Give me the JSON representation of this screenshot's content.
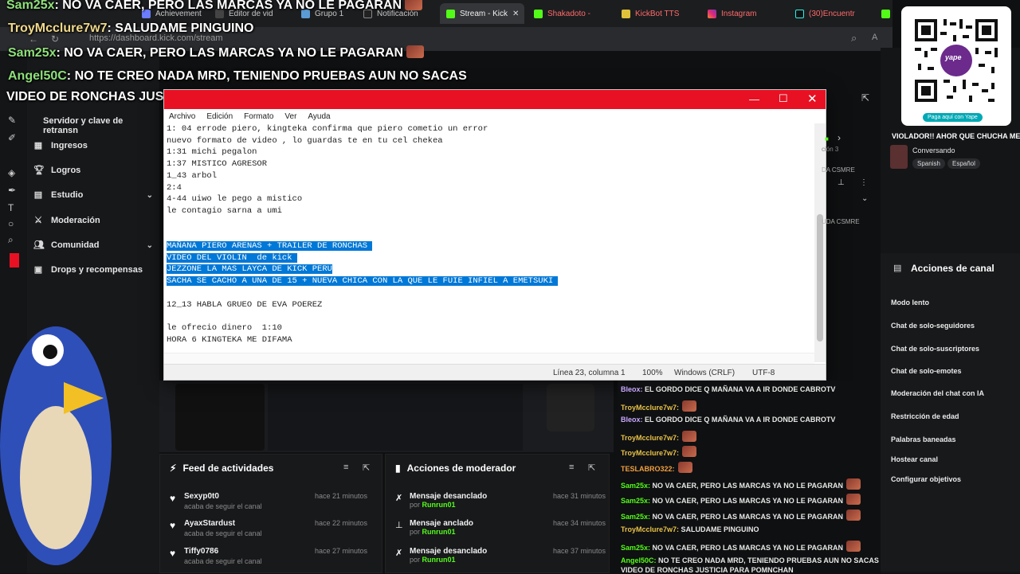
{
  "overlay_chat": [
    {
      "user": "Sam25x",
      "msg": ": NO VA CAER, PERO LAS MARCAS YA NO LE PAGARAN"
    },
    {
      "user": "TroyMcclure7w7",
      "msg": ": SALUDAME PINGUINO"
    },
    {
      "user": "Sam25x",
      "msg": ": NO VA CAER, PERO LAS MARCAS YA NO LE PAGARAN"
    },
    {
      "user": "Angel50C",
      "msg": ": NO TE CREO NADA MRD, TENIENDO PRUEBAS AUN NO SACAS"
    },
    {
      "user": "",
      "msg": "VIDEO DE RONCHAS JUSTICIA PARA POMNCHAN"
    }
  ],
  "browser": {
    "tabs": [
      "Achievement",
      "Editor de vid",
      "Grupo 1",
      "Notificación",
      "Stream - Kick",
      "Shakadoto - ",
      "KickBot TTS ",
      "Instagram",
      "(30)Encuentr"
    ],
    "url": "https://dashboard.kick.com/stream"
  },
  "sidenav": {
    "header": "Servidor y clave de retransn",
    "items": [
      {
        "label": "Ingresos",
        "icon": "chart-icon"
      },
      {
        "label": "Logros",
        "icon": "trophy-icon"
      },
      {
        "label": "Estudio",
        "icon": "studio-icon"
      },
      {
        "label": "Moderación",
        "icon": "sword-icon"
      },
      {
        "label": "Comunidad",
        "icon": "people-icon"
      },
      {
        "label": "Drops y recompensas",
        "icon": "drops-icon"
      }
    ]
  },
  "notepad": {
    "menu": [
      "Archivo",
      "Edición",
      "Formato",
      "Ver",
      "Ayuda"
    ],
    "lines": [
      "1: 04 errode piero, kingteka confirma que piero cometio un error",
      "nuevo formato de video , lo guardas te en tu cel chekea",
      "1:31 michi pegalon",
      "1:37 MISTICO AGRESOR",
      "1_43 arbol",
      "2:4",
      "4-44 uiwo le pego a mistico",
      "le contagio sarna a umi",
      "",
      "",
      "MAÑANA PIERO ARENAS + TRAILER DE RONCHAS ",
      "VIDEO DEL VIOLIN  de kick ",
      "JEZZONE LA MAS LAYCA DE KICK PERU",
      "SACHA SE CACHO A UNA DE 15 + NUEVA CHICA CON LA QUE LE FUIE INFIEL A EMETSUKI ",
      "",
      "12_13 HABLA GRUEO DE EVA POEREZ",
      "",
      "le ofrecio dinero  1:10",
      "HORA 6 KINGTEKA ME DIFAMA"
    ],
    "status": {
      "position": "Línea 23, columna 1",
      "zoom": "100%",
      "eol": "Windows (CRLF)",
      "encoding": "UTF-8"
    }
  },
  "feed": {
    "title": "Feed de actividades",
    "items": [
      {
        "user": "Sexyp0t0",
        "action": "acaba de seguir el canal",
        "time": "hace 21 minutos"
      },
      {
        "user": "AyaxStardust",
        "action": "acaba de seguir el canal",
        "time": "hace 22 minutos"
      },
      {
        "user": "Tiffy0786",
        "action": "acaba de seguir el canal",
        "time": "hace 27 minutos"
      }
    ]
  },
  "modactions": {
    "title": "Acciones de moderador",
    "items": [
      {
        "action": "Mensaje desanclado",
        "by": "por",
        "mod": "Runrun01",
        "time": "hace 31 minutos",
        "icon": "unpin-icon"
      },
      {
        "action": "Mensaje anclado",
        "by": "por",
        "mod": "Runrun01",
        "time": "hace 34 minutos",
        "icon": "pin-icon"
      },
      {
        "action": "Mensaje desanclado",
        "by": "por",
        "mod": "Runrun01",
        "time": "hace 37 minutos",
        "icon": "unpin-icon"
      }
    ]
  },
  "chat": [
    {
      "user": "Bleox:",
      "msg": " EL GORDO DICE Q MAÑANA VA A IR DONDE CABROTV",
      "c": "p"
    },
    {
      "user": "TroyMcclure7w7:",
      "msg": "",
      "c": "y"
    },
    {
      "user": "Bleox:",
      "msg": " EL GORDO DICE Q MAÑANA VA A IR DONDE CABROTV",
      "c": "p"
    },
    {
      "user": "TroyMcclure7w7:",
      "msg": "",
      "c": "y"
    },
    {
      "user": "TroyMcclure7w7:",
      "msg": "",
      "c": "y"
    },
    {
      "user": "TESLABRO322:",
      "msg": "",
      "c": "o"
    },
    {
      "user": "Sam25x:",
      "msg": " NO VA CAER, PERO LAS MARCAS YA NO LE PAGARAN",
      "c": "g"
    },
    {
      "user": "Sam25x:",
      "msg": " NO VA CAER, PERO LAS MARCAS YA NO LE PAGARAN",
      "c": "g"
    },
    {
      "user": "Sam25x:",
      "msg": " NO VA CAER, PERO LAS MARCAS YA NO LE PAGARAN",
      "c": "g"
    },
    {
      "user": "TroyMcclure7w7:",
      "msg": " SALUDAME PINGUINO",
      "c": "y"
    },
    {
      "user": "Sam25x:",
      "msg": " NO VA CAER, PERO LAS MARCAS YA NO LE PAGARAN",
      "c": "g"
    },
    {
      "user": "Angel50C:",
      "msg": " NO TE CREO NADA MRD, TENIENDO PRUEBAS AUN NO SACAS",
      "c": "g"
    },
    {
      "user": "",
      "msg": "VIDEO DE RONCHAS JUSTICIA PARA POMNCHAN",
      "c": "g"
    }
  ],
  "rightcol": {
    "top_msg": "VIOLADOR!! AHOR QUE CHUCHA ME",
    "status": "Conversando",
    "lang1": "Spanish",
    "lang2": "Español",
    "stream_label": "ción 3",
    "csmre1": "DA CSMRE",
    "csmre2": "UDA CSMRE",
    "panel_title": "Acciones de canal",
    "links": [
      "Modo lento",
      "Chat de solo-seguidores",
      "Chat de solo-suscriptores",
      "Chat de solo-emotes",
      "Moderación del chat con IA",
      "Restricción de edad",
      "Palabras baneadas",
      "Hostear canal",
      "Configurar objetivos"
    ]
  },
  "qr": {
    "brand": "yape",
    "cta": "Paga aquí con Yape"
  },
  "colors": {
    "kick_green": "#53fc18",
    "notepad_title": "#e81123",
    "selection": "#0078d7"
  }
}
